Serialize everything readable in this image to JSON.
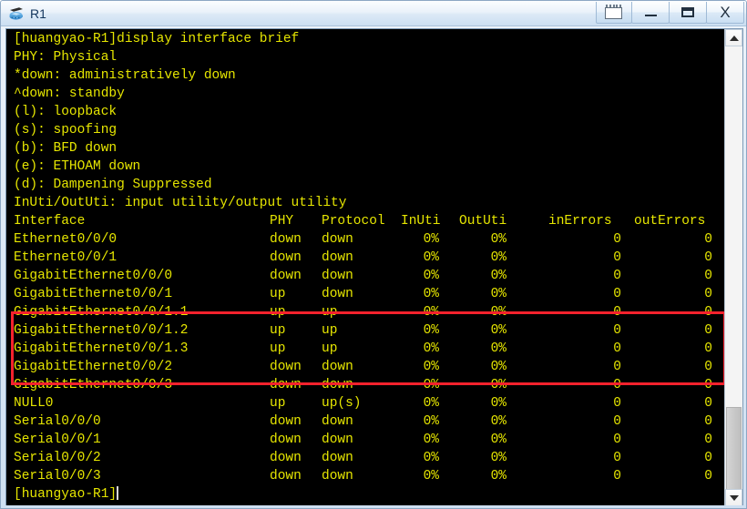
{
  "window": {
    "title": "R1",
    "app_icon": "router-icon",
    "controls": {
      "notebook_label": "",
      "minimize_label": "",
      "maximize_label": "",
      "close_label": "X"
    }
  },
  "terminal": {
    "prompt_command": "[huangyao-R1]display interface brief",
    "legend": [
      "PHY: Physical",
      "*down: administratively down",
      "^down: standby",
      "(l): loopback",
      "(s): spoofing",
      "(b): BFD down",
      "(e): ETHOAM down",
      "(d): Dampening Suppressed",
      "InUti/OutUti: input utility/output utility"
    ],
    "columns": {
      "interface": "Interface",
      "phy": "PHY",
      "protocol": "Protocol",
      "inuti": "InUti",
      "oututi": "OutUti",
      "inerrors": "inErrors",
      "outerrors": "outErrors"
    },
    "rows": [
      {
        "interface": "Ethernet0/0/0",
        "phy": "down",
        "protocol": "down",
        "inuti": "0%",
        "oututi": "0%",
        "inerrors": "0",
        "outerrors": "0",
        "highlighted": false
      },
      {
        "interface": "Ethernet0/0/1",
        "phy": "down",
        "protocol": "down",
        "inuti": "0%",
        "oututi": "0%",
        "inerrors": "0",
        "outerrors": "0",
        "highlighted": false
      },
      {
        "interface": "GigabitEthernet0/0/0",
        "phy": "down",
        "protocol": "down",
        "inuti": "0%",
        "oututi": "0%",
        "inerrors": "0",
        "outerrors": "0",
        "highlighted": false
      },
      {
        "interface": "GigabitEthernet0/0/1",
        "phy": "up",
        "protocol": "down",
        "inuti": "0%",
        "oututi": "0%",
        "inerrors": "0",
        "outerrors": "0",
        "highlighted": true
      },
      {
        "interface": "GigabitEthernet0/0/1.1",
        "phy": "up",
        "protocol": "up",
        "inuti": "0%",
        "oututi": "0%",
        "inerrors": "0",
        "outerrors": "0",
        "highlighted": true
      },
      {
        "interface": "GigabitEthernet0/0/1.2",
        "phy": "up",
        "protocol": "up",
        "inuti": "0%",
        "oututi": "0%",
        "inerrors": "0",
        "outerrors": "0",
        "highlighted": true
      },
      {
        "interface": "GigabitEthernet0/0/1.3",
        "phy": "up",
        "protocol": "up",
        "inuti": "0%",
        "oututi": "0%",
        "inerrors": "0",
        "outerrors": "0",
        "highlighted": true
      },
      {
        "interface": "GigabitEthernet0/0/2",
        "phy": "down",
        "protocol": "down",
        "inuti": "0%",
        "oututi": "0%",
        "inerrors": "0",
        "outerrors": "0",
        "highlighted": false
      },
      {
        "interface": "GigabitEthernet0/0/3",
        "phy": "down",
        "protocol": "down",
        "inuti": "0%",
        "oututi": "0%",
        "inerrors": "0",
        "outerrors": "0",
        "highlighted": false
      },
      {
        "interface": "NULL0",
        "phy": "up",
        "protocol": "up(s)",
        "inuti": "0%",
        "oututi": "0%",
        "inerrors": "0",
        "outerrors": "0",
        "highlighted": false
      },
      {
        "interface": "Serial0/0/0",
        "phy": "down",
        "protocol": "down",
        "inuti": "0%",
        "oututi": "0%",
        "inerrors": "0",
        "outerrors": "0",
        "highlighted": false
      },
      {
        "interface": "Serial0/0/1",
        "phy": "down",
        "protocol": "down",
        "inuti": "0%",
        "oututi": "0%",
        "inerrors": "0",
        "outerrors": "0",
        "highlighted": false
      },
      {
        "interface": "Serial0/0/2",
        "phy": "down",
        "protocol": "down",
        "inuti": "0%",
        "oututi": "0%",
        "inerrors": "0",
        "outerrors": "0",
        "highlighted": false
      },
      {
        "interface": "Serial0/0/3",
        "phy": "down",
        "protocol": "down",
        "inuti": "0%",
        "oututi": "0%",
        "inerrors": "0",
        "outerrors": "0",
        "highlighted": false
      }
    ],
    "trailing_prompt": "[huangyao-R1]",
    "text_color": "#e6e600",
    "background_color": "#000000"
  },
  "annotation": {
    "highlight_color": "#f5222d",
    "note": "red rectangle around GigabitEthernet0/0/1 and its subinterfaces"
  },
  "scrollbar": {
    "up_arrow": "chevron-up-icon",
    "down_arrow": "chevron-down-icon"
  }
}
